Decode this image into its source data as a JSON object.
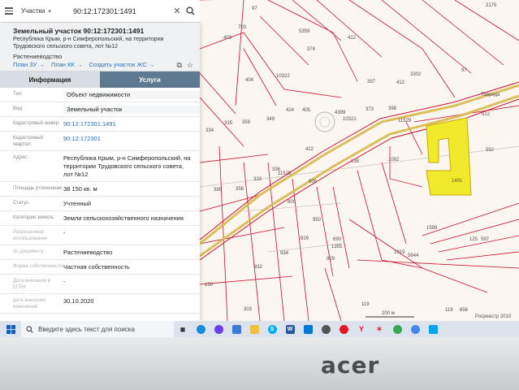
{
  "search": {
    "type_label": "Участки",
    "query": "90:12:172301:1491"
  },
  "parcel": {
    "title": "Земельный участок 90:12:172301:1491",
    "address_head": "Республика Крым, р-н Симферопольский, на территории Трудовского сельского совета, лот №12",
    "use": "Растениеводство",
    "links": [
      "План ЗУ →",
      "План КК →",
      "Создать участок ЖС →"
    ]
  },
  "tabs": [
    "Информация",
    "Услуги"
  ],
  "attributes": [
    {
      "label": "Тип:",
      "value": "Объект недвижимости",
      "style": "field"
    },
    {
      "label": "Вид:",
      "value": "Земельный участок",
      "style": "field"
    },
    {
      "label": "Кадастровый номер:",
      "value": "90:12:172301:1491",
      "style": "link"
    },
    {
      "label": "Кадастровый квартал:",
      "value": "90:12:172301",
      "style": "link"
    },
    {
      "label": "Адрес:",
      "value": "Республика Крым, р-н Симферопольский, на территории Трудовского сельского совета, лот №12",
      "style": ""
    },
    {
      "label": "Площадь уточненная:",
      "value": "38 150 кв. м",
      "style": ""
    },
    {
      "label": "Статус:",
      "value": "Учтенный",
      "style": ""
    },
    {
      "label": "Категория земель:",
      "value": "Земли сельскохозяйственного назначения",
      "style": ""
    },
    {
      "label": "Разрешенное использование",
      "value": "-",
      "style": "faded"
    },
    {
      "label": "по документу:",
      "value": "Растениеводство",
      "style": "faded"
    },
    {
      "label": "Форма собственности",
      "value": "Частная собственность",
      "style": "faded"
    },
    {
      "label": "Дата внесения в ЕГРН",
      "value": "-",
      "style": "faded"
    },
    {
      "label": "дата внесения изменений",
      "value": "30.10.2020",
      "style": "faded"
    }
  ],
  "map": {
    "labels": [
      "97",
      "703",
      "403",
      "5359",
      "412",
      "374",
      "97",
      "397",
      "412",
      "3302",
      "404",
      "10322",
      "4399",
      "373",
      "398",
      "424",
      "349",
      "405",
      "10321",
      "11529",
      "1092",
      "512",
      "552",
      "334",
      "335",
      "359",
      "422",
      "138",
      "336",
      "11529",
      "333",
      "385",
      "358",
      "800",
      "906",
      "950",
      "929",
      "934",
      "1355",
      "690",
      "929",
      "932",
      "150",
      "303",
      "1919",
      "5644",
      "119",
      "656",
      "597",
      "1599",
      "125",
      "119",
      "2175",
      "1491"
    ],
    "scale_label": "200 м",
    "copyright": "Росреестр 2010",
    "road_label": "Таврида"
  },
  "taskbar": {
    "search_placeholder": "Введите здесь текст для поиска"
  },
  "bezel": {
    "brand": "acer"
  },
  "colors": {
    "highlight": "#f1ea2c",
    "road": "#d9b84a",
    "boundary": "#c8102e"
  }
}
